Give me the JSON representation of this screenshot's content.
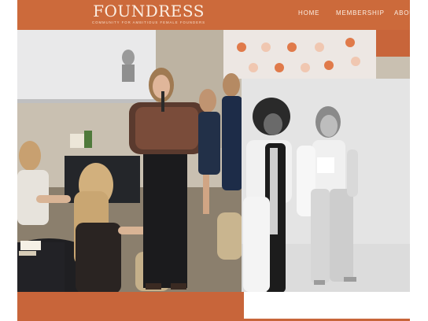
{
  "brand": {
    "name": "FOUNDRESS",
    "tagline": "COMMUNITY FOR AMBITIOUS FEMALE FOUNDERS"
  },
  "nav": {
    "items": [
      {
        "label": "HOME"
      },
      {
        "label": "MEMBERSHIP"
      },
      {
        "label": "ABOU"
      }
    ]
  },
  "colors": {
    "brand": "#cc6a3b",
    "brand_text": "#fbeee3"
  },
  "images": {
    "event": "event-speaker-photo",
    "portrait": "two-women-portrait"
  }
}
